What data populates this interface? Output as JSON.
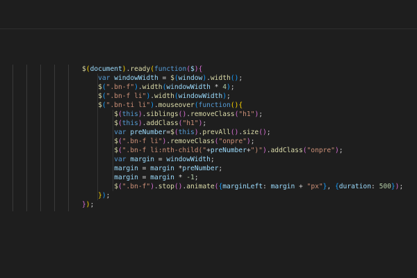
{
  "colors": {
    "background": "#1e1e1e",
    "function": "#dcdcaa",
    "variable": "#9cdcfe",
    "keyword": "#569cd6",
    "string": "#ce9178",
    "number": "#b5cea8",
    "plain": "#d4d4d4",
    "bracket_level_1": "#ffd700",
    "bracket_level_2": "#da70d6",
    "bracket_level_3": "#179fff"
  },
  "code": {
    "lines": [
      {
        "indent": "",
        "tokens": [
          {
            "t": "$",
            "c": "fn"
          },
          {
            "t": "(",
            "c": "p1"
          },
          {
            "t": "document",
            "c": "var"
          },
          {
            "t": ")",
            "c": "p1"
          },
          {
            "t": ".",
            "c": "pl"
          },
          {
            "t": "ready",
            "c": "fn"
          },
          {
            "t": "(",
            "c": "p1"
          },
          {
            "t": "function",
            "c": "kw"
          },
          {
            "t": "(",
            "c": "p2"
          },
          {
            "t": "$",
            "c": "var"
          },
          {
            "t": ")",
            "c": "p2"
          },
          {
            "t": "{",
            "c": "p2"
          }
        ]
      },
      {
        "indent": "    ",
        "tokens": [
          {
            "t": "var ",
            "c": "kw"
          },
          {
            "t": "windowWidth",
            "c": "var"
          },
          {
            "t": " = ",
            "c": "pl"
          },
          {
            "t": "$",
            "c": "fn"
          },
          {
            "t": "(",
            "c": "p3"
          },
          {
            "t": "window",
            "c": "var"
          },
          {
            "t": ")",
            "c": "p3"
          },
          {
            "t": ".",
            "c": "pl"
          },
          {
            "t": "width",
            "c": "fn"
          },
          {
            "t": "()",
            "c": "p3"
          },
          {
            "t": ";",
            "c": "pl"
          }
        ]
      },
      {
        "indent": "    ",
        "tokens": [
          {
            "t": "$",
            "c": "fn"
          },
          {
            "t": "(",
            "c": "p3"
          },
          {
            "t": "\".bn-f\"",
            "c": "str"
          },
          {
            "t": ")",
            "c": "p3"
          },
          {
            "t": ".",
            "c": "pl"
          },
          {
            "t": "width",
            "c": "fn"
          },
          {
            "t": "(",
            "c": "p3"
          },
          {
            "t": "windowWidth",
            "c": "var"
          },
          {
            "t": " * ",
            "c": "pl"
          },
          {
            "t": "4",
            "c": "num"
          },
          {
            "t": ")",
            "c": "p3"
          },
          {
            "t": ";",
            "c": "pl"
          }
        ]
      },
      {
        "indent": "    ",
        "tokens": [
          {
            "t": "$",
            "c": "fn"
          },
          {
            "t": "(",
            "c": "p3"
          },
          {
            "t": "\".bn-f li\"",
            "c": "str"
          },
          {
            "t": ")",
            "c": "p3"
          },
          {
            "t": ".",
            "c": "pl"
          },
          {
            "t": "width",
            "c": "fn"
          },
          {
            "t": "(",
            "c": "p3"
          },
          {
            "t": "windowWidth",
            "c": "var"
          },
          {
            "t": ")",
            "c": "p3"
          },
          {
            "t": ";",
            "c": "pl"
          }
        ]
      },
      {
        "indent": "    ",
        "tokens": [
          {
            "t": "$",
            "c": "fn"
          },
          {
            "t": "(",
            "c": "p3"
          },
          {
            "t": "\".bn-ti li\"",
            "c": "str"
          },
          {
            "t": ")",
            "c": "p3"
          },
          {
            "t": ".",
            "c": "pl"
          },
          {
            "t": "mouseover",
            "c": "fn"
          },
          {
            "t": "(",
            "c": "p3"
          },
          {
            "t": "function",
            "c": "kw"
          },
          {
            "t": "()",
            "c": "p1"
          },
          {
            "t": "{",
            "c": "p1"
          }
        ]
      },
      {
        "indent": "        ",
        "tokens": [
          {
            "t": "$",
            "c": "fn"
          },
          {
            "t": "(",
            "c": "p2"
          },
          {
            "t": "this",
            "c": "kw"
          },
          {
            "t": ")",
            "c": "p2"
          },
          {
            "t": ".",
            "c": "pl"
          },
          {
            "t": "siblings",
            "c": "fn"
          },
          {
            "t": "()",
            "c": "p2"
          },
          {
            "t": ".",
            "c": "pl"
          },
          {
            "t": "removeClass",
            "c": "fn"
          },
          {
            "t": "(",
            "c": "p2"
          },
          {
            "t": "\"h1\"",
            "c": "str"
          },
          {
            "t": ")",
            "c": "p2"
          },
          {
            "t": ";",
            "c": "pl"
          }
        ]
      },
      {
        "indent": "        ",
        "tokens": [
          {
            "t": "$",
            "c": "fn"
          },
          {
            "t": "(",
            "c": "p2"
          },
          {
            "t": "this",
            "c": "kw"
          },
          {
            "t": ")",
            "c": "p2"
          },
          {
            "t": ".",
            "c": "pl"
          },
          {
            "t": "addClass",
            "c": "fn"
          },
          {
            "t": "(",
            "c": "p2"
          },
          {
            "t": "\"h1\"",
            "c": "str"
          },
          {
            "t": ")",
            "c": "p2"
          },
          {
            "t": ";",
            "c": "pl"
          }
        ]
      },
      {
        "indent": "        ",
        "tokens": [
          {
            "t": "var ",
            "c": "kw"
          },
          {
            "t": "preNumber",
            "c": "var"
          },
          {
            "t": "=",
            "c": "pl"
          },
          {
            "t": "$",
            "c": "fn"
          },
          {
            "t": "(",
            "c": "p2"
          },
          {
            "t": "this",
            "c": "kw"
          },
          {
            "t": ")",
            "c": "p2"
          },
          {
            "t": ".",
            "c": "pl"
          },
          {
            "t": "prevAll",
            "c": "fn"
          },
          {
            "t": "()",
            "c": "p2"
          },
          {
            "t": ".",
            "c": "pl"
          },
          {
            "t": "size",
            "c": "fn"
          },
          {
            "t": "()",
            "c": "p2"
          },
          {
            "t": ";",
            "c": "pl"
          }
        ]
      },
      {
        "indent": "        ",
        "tokens": [
          {
            "t": "$",
            "c": "fn"
          },
          {
            "t": "(",
            "c": "p2"
          },
          {
            "t": "\".bn-f li\"",
            "c": "str"
          },
          {
            "t": ")",
            "c": "p2"
          },
          {
            "t": ".",
            "c": "pl"
          },
          {
            "t": "removeClass",
            "c": "fn"
          },
          {
            "t": "(",
            "c": "p2"
          },
          {
            "t": "\"onpre\"",
            "c": "str"
          },
          {
            "t": ")",
            "c": "p2"
          },
          {
            "t": ";",
            "c": "pl"
          }
        ]
      },
      {
        "indent": "        ",
        "tokens": [
          {
            "t": "$",
            "c": "fn"
          },
          {
            "t": "(",
            "c": "p2"
          },
          {
            "t": "\".bn-f li:nth-child(\"",
            "c": "str"
          },
          {
            "t": "+",
            "c": "pl"
          },
          {
            "t": "preNumber",
            "c": "var"
          },
          {
            "t": "+",
            "c": "pl"
          },
          {
            "t": "\")\"",
            "c": "str"
          },
          {
            "t": ")",
            "c": "p2"
          },
          {
            "t": ".",
            "c": "pl"
          },
          {
            "t": "addClass",
            "c": "fn"
          },
          {
            "t": "(",
            "c": "p2"
          },
          {
            "t": "\"onpre\"",
            "c": "str"
          },
          {
            "t": ")",
            "c": "p2"
          },
          {
            "t": ";",
            "c": "pl"
          }
        ]
      },
      {
        "indent": "        ",
        "tokens": [
          {
            "t": "var ",
            "c": "kw"
          },
          {
            "t": "margin",
            "c": "var"
          },
          {
            "t": " = ",
            "c": "pl"
          },
          {
            "t": "windowWidth",
            "c": "var"
          },
          {
            "t": ";",
            "c": "pl"
          }
        ]
      },
      {
        "indent": "        ",
        "tokens": [
          {
            "t": "margin",
            "c": "var"
          },
          {
            "t": " = ",
            "c": "pl"
          },
          {
            "t": "margin",
            "c": "var"
          },
          {
            "t": " *",
            "c": "pl"
          },
          {
            "t": "preNumber",
            "c": "var"
          },
          {
            "t": ";",
            "c": "pl"
          }
        ]
      },
      {
        "indent": "        ",
        "tokens": [
          {
            "t": "margin",
            "c": "var"
          },
          {
            "t": " = ",
            "c": "pl"
          },
          {
            "t": "margin",
            "c": "var"
          },
          {
            "t": " * ",
            "c": "pl"
          },
          {
            "t": "-1",
            "c": "num"
          },
          {
            "t": ";",
            "c": "pl"
          }
        ]
      },
      {
        "indent": "        ",
        "tokens": [
          {
            "t": "$",
            "c": "fn"
          },
          {
            "t": "(",
            "c": "p2"
          },
          {
            "t": "\".bn-f\"",
            "c": "str"
          },
          {
            "t": ")",
            "c": "p2"
          },
          {
            "t": ".",
            "c": "pl"
          },
          {
            "t": "stop",
            "c": "fn"
          },
          {
            "t": "()",
            "c": "p2"
          },
          {
            "t": ".",
            "c": "pl"
          },
          {
            "t": "animate",
            "c": "fn"
          },
          {
            "t": "(",
            "c": "p2"
          },
          {
            "t": "{",
            "c": "p3"
          },
          {
            "t": "marginLeft",
            "c": "var"
          },
          {
            "t": ": ",
            "c": "pl"
          },
          {
            "t": "margin",
            "c": "var"
          },
          {
            "t": " + ",
            "c": "pl"
          },
          {
            "t": "\"px\"",
            "c": "str"
          },
          {
            "t": "}",
            "c": "p3"
          },
          {
            "t": ", ",
            "c": "pl"
          },
          {
            "t": "{",
            "c": "p3"
          },
          {
            "t": "duration",
            "c": "var"
          },
          {
            "t": ": ",
            "c": "pl"
          },
          {
            "t": "500",
            "c": "num"
          },
          {
            "t": "}",
            "c": "p3"
          },
          {
            "t": ")",
            "c": "p2"
          },
          {
            "t": ";",
            "c": "pl"
          }
        ]
      },
      {
        "indent": "    ",
        "tokens": [
          {
            "t": "}",
            "c": "p1"
          },
          {
            "t": ")",
            "c": "p3"
          },
          {
            "t": ";",
            "c": "pl"
          }
        ]
      },
      {
        "indent": "",
        "tokens": [
          {
            "t": "}",
            "c": "p2"
          },
          {
            "t": ")",
            "c": "p1"
          },
          {
            "t": ";",
            "c": "pl"
          }
        ]
      }
    ]
  }
}
